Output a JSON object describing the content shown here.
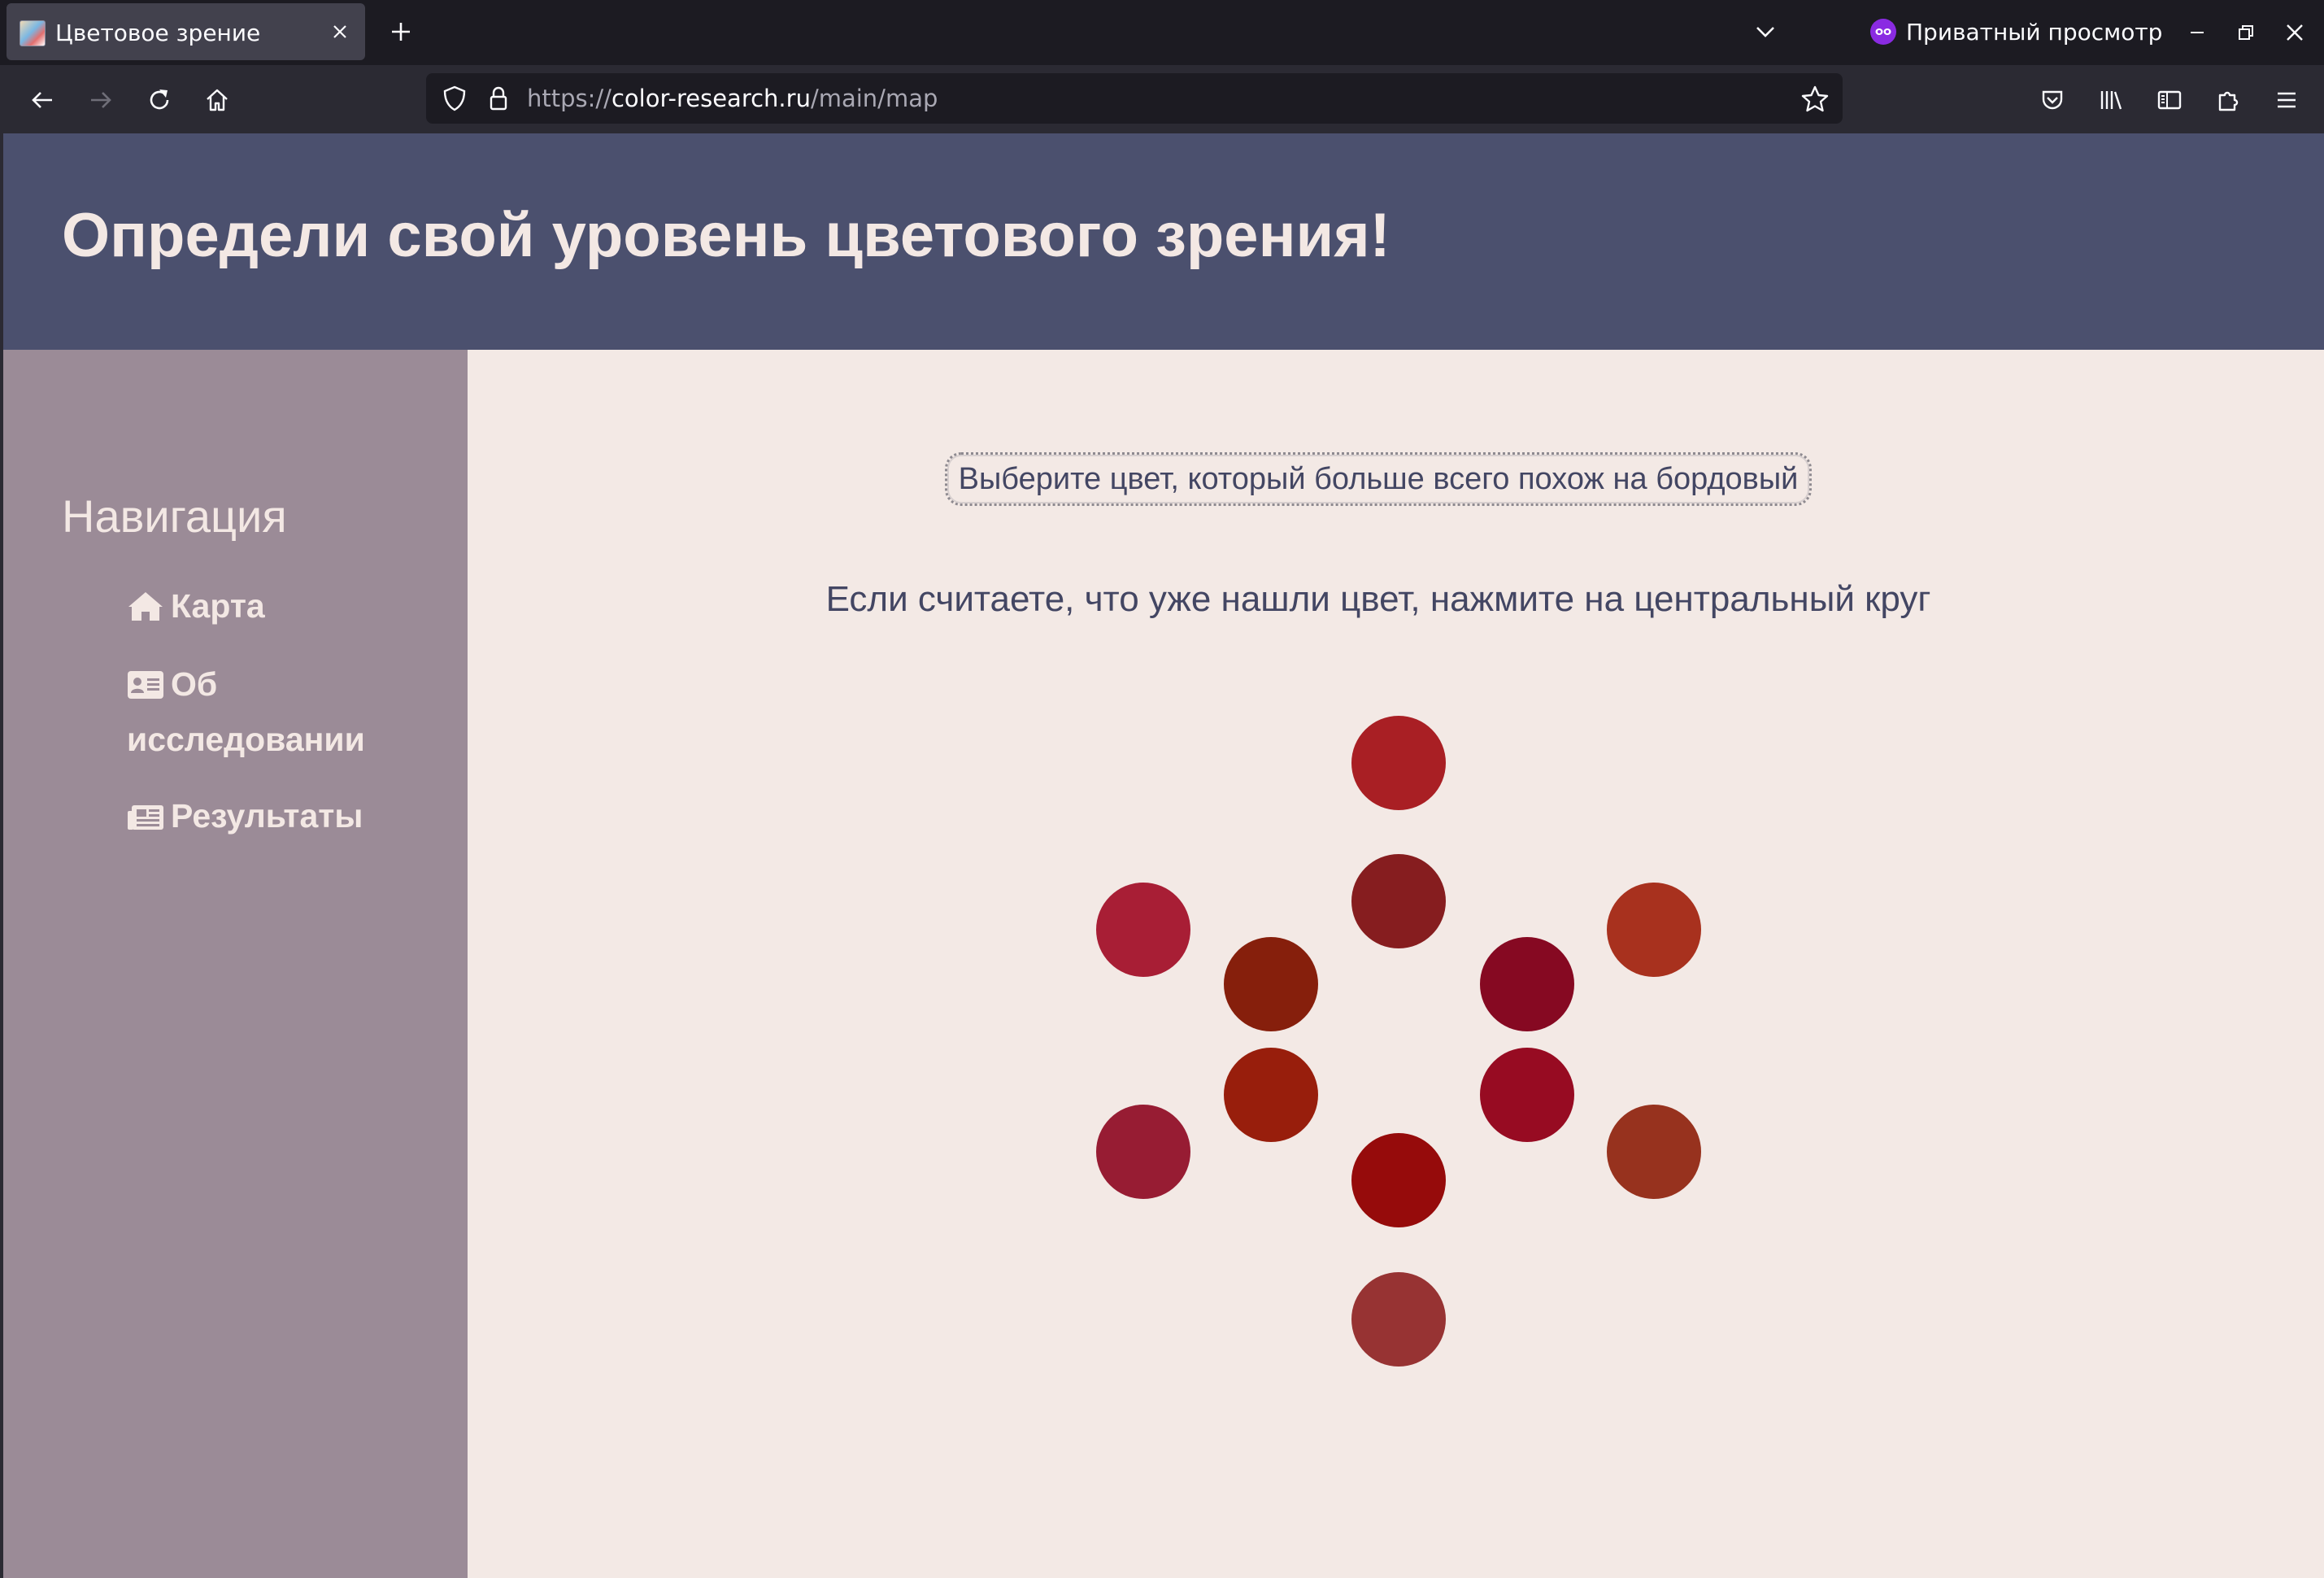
{
  "browser": {
    "tab_title": "Цветовое зрение",
    "private_label": "Приватный просмотр",
    "url_scheme": "https://",
    "url_host": "color-research.ru",
    "url_path": "/main/map"
  },
  "site": {
    "title": "Определи свой уровень цветового зрения!"
  },
  "sidebar": {
    "heading": "Навигация",
    "items": [
      {
        "label": "Карта",
        "icon": "home-icon"
      },
      {
        "label": "Об исследовании",
        "icon": "id-card-icon"
      },
      {
        "label": "Результаты",
        "icon": "newspaper-icon"
      }
    ]
  },
  "task": {
    "target_button": "Выберите цвет, который больше всего похож на бордовый",
    "hint": "Если считаете, что уже нашли цвет, нажмите на центральный круг"
  },
  "swatches": {
    "top": "#a91f24",
    "upper_center": "#861d1f",
    "upper_left": "#a81e35",
    "upper_right": "#a8311e",
    "inner_upper_left": "#861f0c",
    "inner_upper_right": "#860922",
    "inner_lower_left": "#981e0c",
    "inner_lower_right": "#970b22",
    "lower_left": "#971c33",
    "lower_right": "#97321e",
    "lower_center": "#960b0b",
    "bottom": "#973333"
  }
}
